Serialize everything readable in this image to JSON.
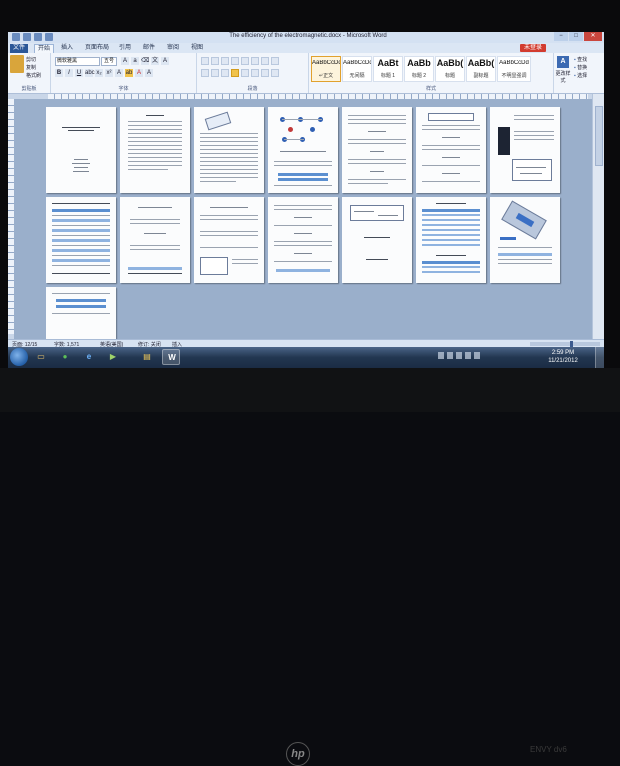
{
  "window": {
    "title": "The efficiency of the electromagnetic.docx - Microsoft Word",
    "controls": [
      "−",
      "□",
      "✕"
    ]
  },
  "tabs": [
    "文件",
    "开始",
    "插入",
    "页面布局",
    "引用",
    "邮件",
    "审阅",
    "视图"
  ],
  "login_label": "未登录",
  "ribbon": {
    "clipboard": {
      "label": "剪贴板",
      "paste": "粘贴",
      "cut": "剪切",
      "copy": "复制",
      "format_painter": "格式刷"
    },
    "font": {
      "label": "字体",
      "family": "微软雅黑",
      "size": "五号"
    },
    "paragraph": {
      "label": "段落"
    },
    "styles": {
      "label": "样式",
      "items": [
        {
          "sample": "AaBbCcDd",
          "name": "↵正文"
        },
        {
          "sample": "AaBbCcDd",
          "name": "无间隔"
        },
        {
          "sample": "AaBt",
          "name": "标题 1"
        },
        {
          "sample": "AaBb",
          "name": "标题 2"
        },
        {
          "sample": "AaBb(",
          "name": "标题"
        },
        {
          "sample": "AaBb(",
          "name": "副标题"
        },
        {
          "sample": "AaBbCcDd",
          "name": "不明显强调"
        }
      ]
    },
    "change_styles": "更改样式",
    "editing": {
      "label": "编辑",
      "find": "查找",
      "replace": "替换",
      "select": "选择"
    }
  },
  "status": {
    "page": "页面: 12/15",
    "words": "字数: 1,571",
    "language": "英语(美国)",
    "mode": "插入",
    "revision": "修订: 关闭"
  },
  "clock": {
    "time": "2:59 PM",
    "date": "11/21/2012"
  },
  "bezel": {
    "model": "ENVY dv6"
  },
  "taskbar": {
    "icons": [
      {
        "name": "windows-explorer-icon",
        "glyph": "▭",
        "color": "#d8a94a"
      },
      {
        "name": "chrome-icon",
        "glyph": "●",
        "color": "#3d9a4d"
      },
      {
        "name": "ie-icon",
        "glyph": "e",
        "color": "#3b8de0"
      },
      {
        "name": "media-icon",
        "glyph": "▶",
        "color": "#6a9b3a"
      },
      {
        "name": "folder-icon",
        "glyph": "▤",
        "color": "#e0b043"
      },
      {
        "name": "word-icon",
        "glyph": "W",
        "color": "#2b5797"
      }
    ]
  }
}
